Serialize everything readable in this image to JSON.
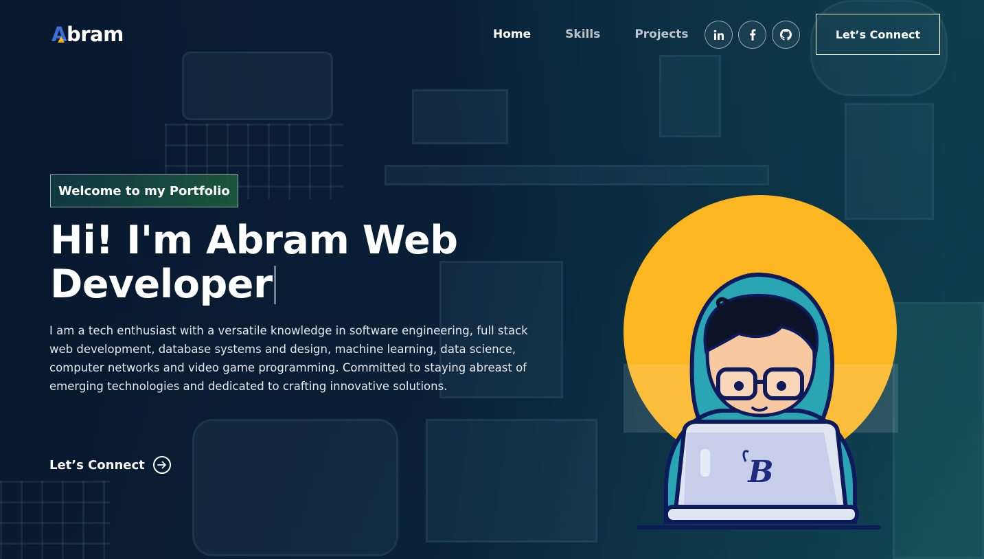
{
  "logo": {
    "initial": "A",
    "rest": "bram"
  },
  "nav": {
    "links": [
      "Home",
      "Skills",
      "Projects"
    ],
    "active": "Home",
    "socials": [
      "linkedin-icon",
      "facebook-icon",
      "github-icon"
    ],
    "cta_label": "Let’s Connect"
  },
  "hero": {
    "tagline": "Welcome to my Portfolio",
    "headline_line1": "Hi! I'm Abram Web",
    "headline_line2": "Developer",
    "bio": "I am a tech enthusiast with a versatile knowledge in software engineering, full stack web development, database systems and design, machine learning, data science, computer networks and video game programming. Committed to staying abreast of emerging technologies and dedicated to crafting innovative solutions.",
    "cta_label": "Let’s Connect"
  },
  "illustration": {
    "laptop_logo": "B"
  },
  "colors": {
    "accent_yellow": "#fbb622",
    "logo_blue": "#3b6fd1",
    "hoodie_teal": "#2aa5b4",
    "bg_dark": "#0b2a3e"
  }
}
